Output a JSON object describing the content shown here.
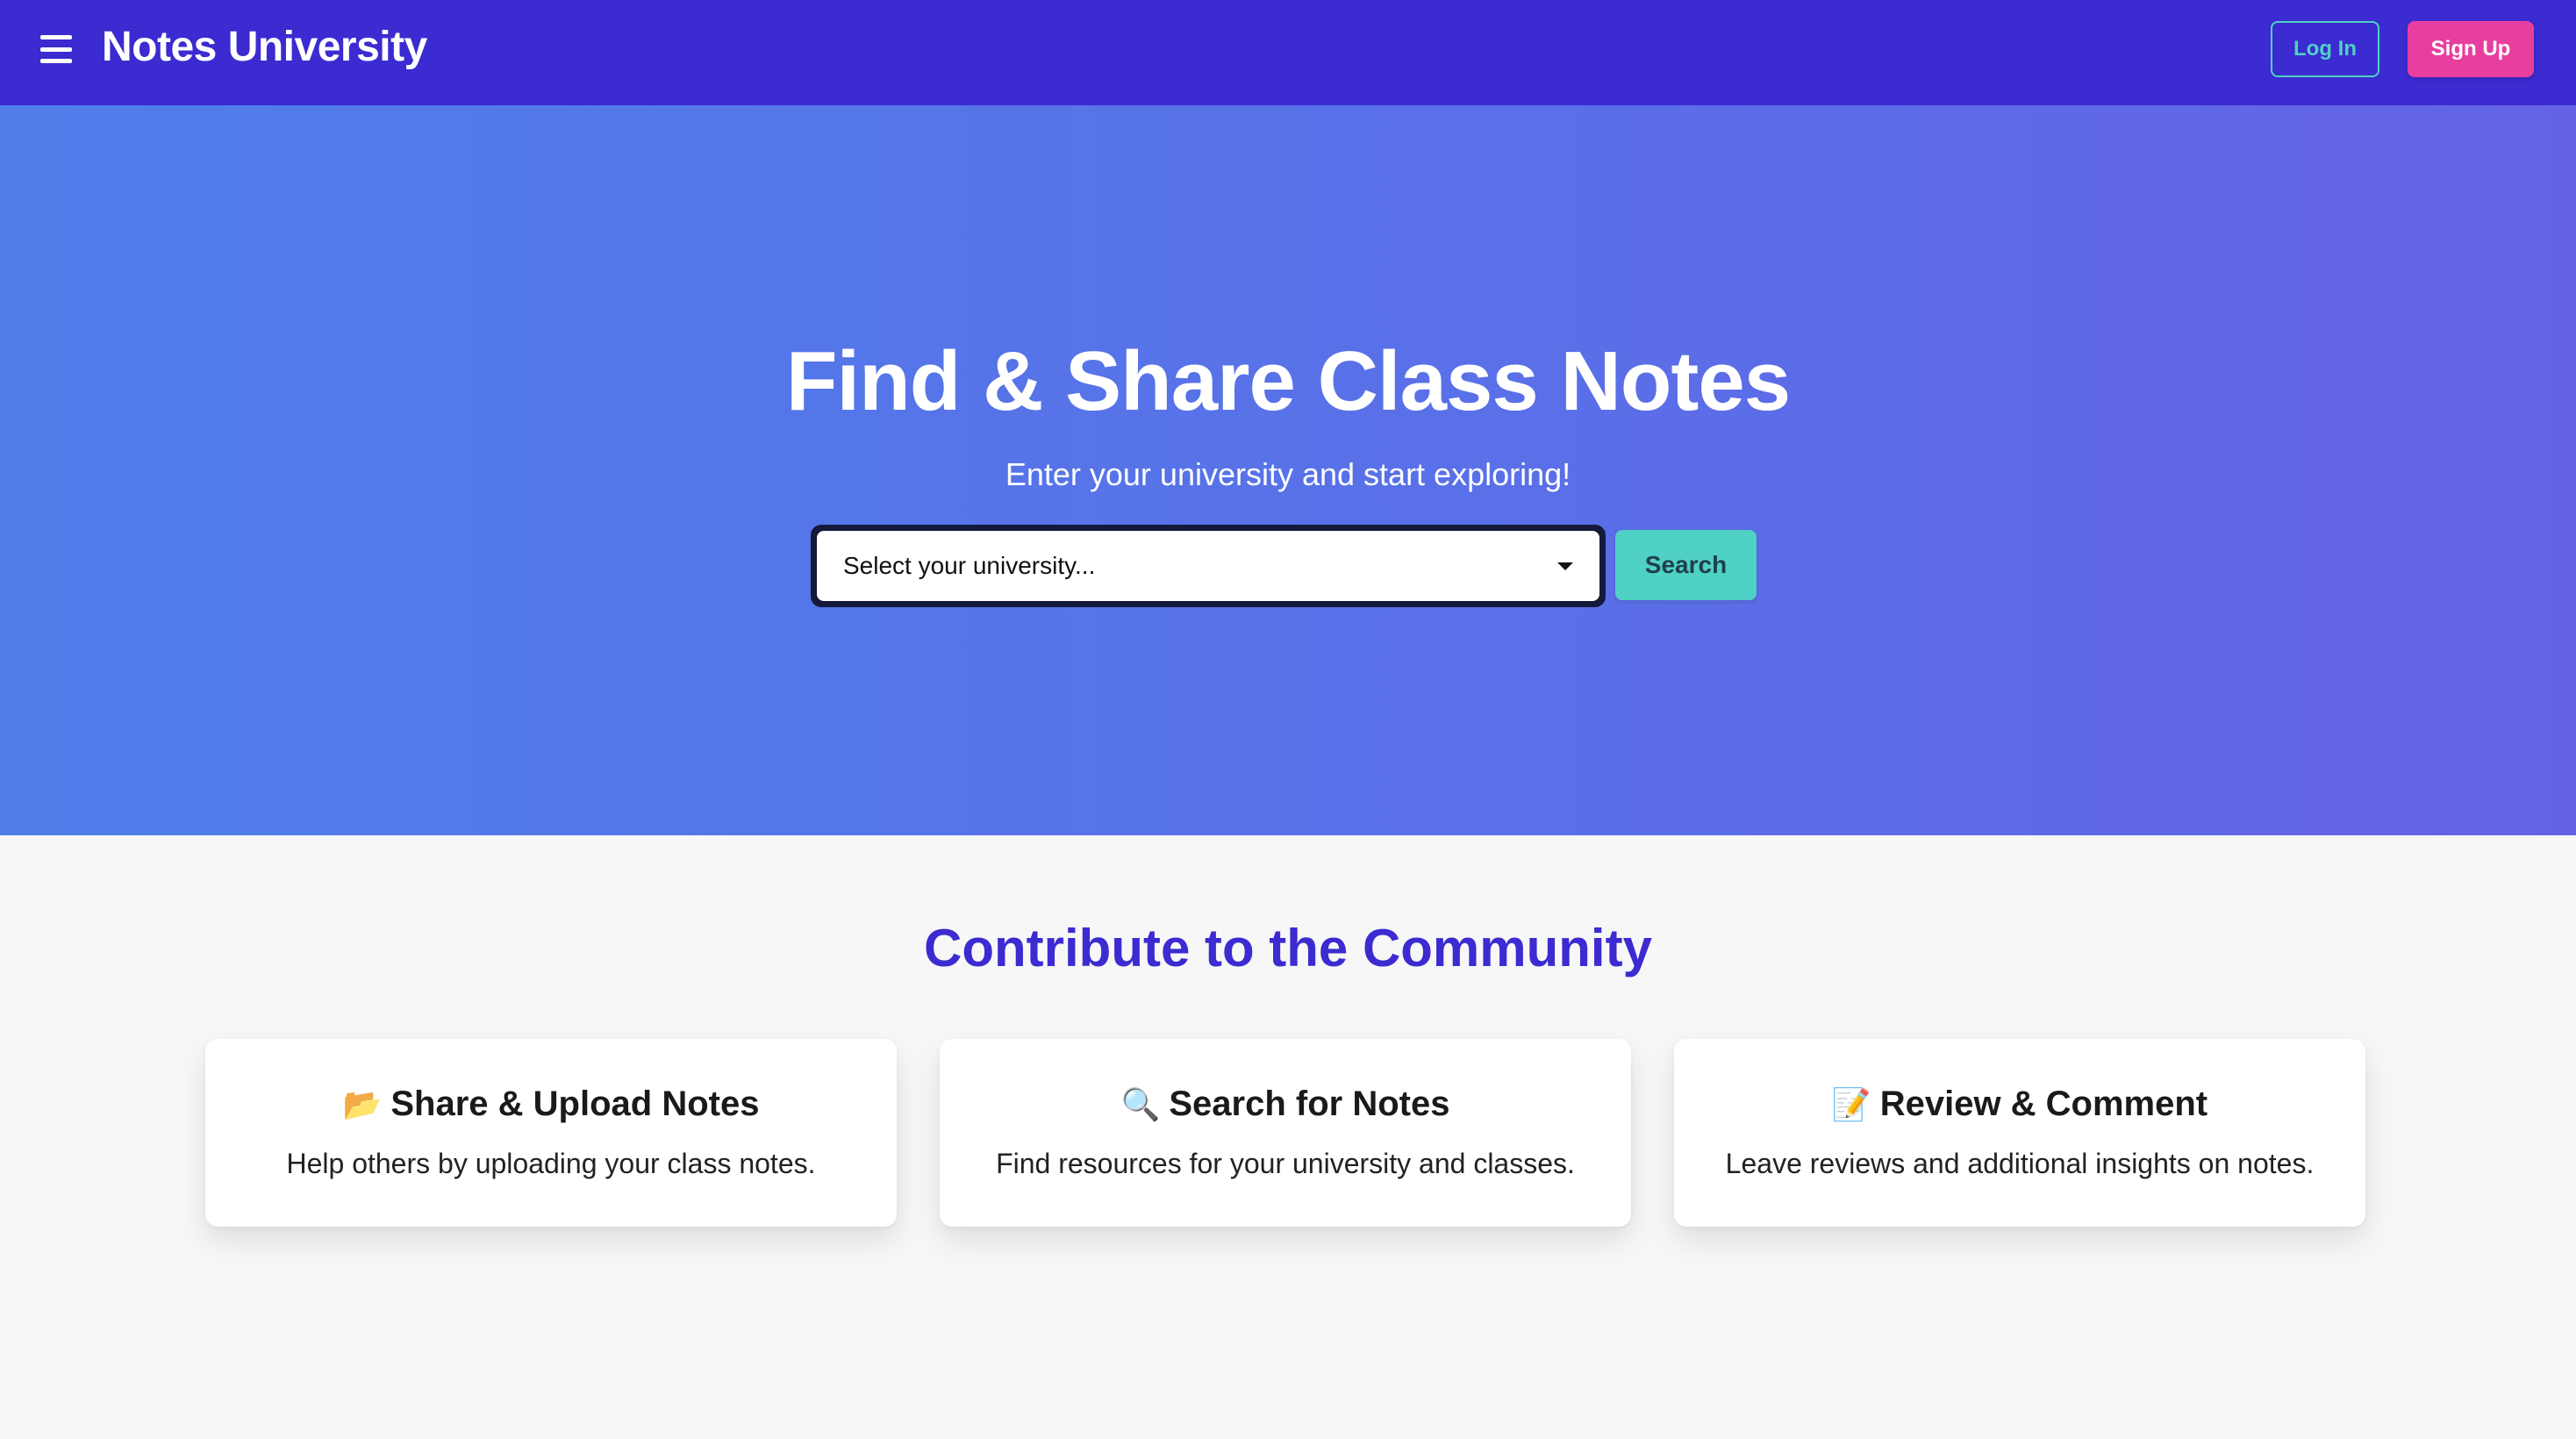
{
  "nav": {
    "brand": "Notes University",
    "login_label": "Log In",
    "signup_label": "Sign Up"
  },
  "hero": {
    "title": "Find & Share Class Notes",
    "subtitle": "Enter your university and start exploring!",
    "select_placeholder": "Select your university...",
    "search_label": "Search"
  },
  "community": {
    "title": "Contribute to the Community",
    "cards": [
      {
        "icon": "📂",
        "icon_name": "folder-icon",
        "title": "Share & Upload Notes",
        "desc": "Help others by uploading your class notes."
      },
      {
        "icon": "🔍",
        "icon_name": "magnifier-icon",
        "title": "Search for Notes",
        "desc": "Find resources for your university and classes."
      },
      {
        "icon": "📝",
        "icon_name": "memo-icon",
        "title": "Review & Comment",
        "desc": "Leave reviews and additional insights on notes."
      }
    ]
  },
  "colors": {
    "nav_bg": "#3b2bd1",
    "accent_teal": "#4fd1c5",
    "accent_pink": "#e83e9f",
    "hero_start": "#4f7ee9",
    "hero_end": "#6463e6"
  }
}
